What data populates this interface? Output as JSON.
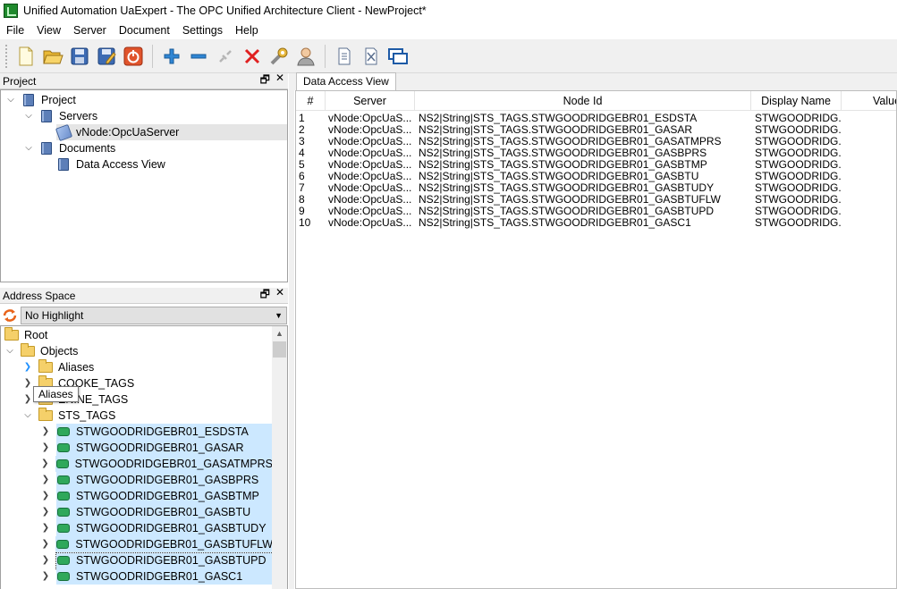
{
  "window": {
    "title": "Unified Automation UaExpert - The OPC Unified Architecture Client - NewProject*"
  },
  "menu": [
    "File",
    "View",
    "Server",
    "Document",
    "Settings",
    "Help"
  ],
  "toolbar": {
    "buttons": [
      "new-project-icon",
      "open-project-icon",
      "save-project-icon",
      "save-as-icon",
      "quit-icon",
      "add-server-icon",
      "remove-server-icon",
      "connect-icon",
      "disconnect-icon",
      "settings-icon",
      "user-icon",
      "add-document-icon",
      "remove-document-icon",
      "window-icon"
    ]
  },
  "project_panel": {
    "title": "Project",
    "float_glyph": "🗗",
    "close_glyph": "✕",
    "tree": [
      {
        "label": "Project",
        "level": 0,
        "expanded": true,
        "icon": "book-icon"
      },
      {
        "label": "Servers",
        "level": 1,
        "expanded": true,
        "icon": "book-icon"
      },
      {
        "label": "vNode:OpcUaServer",
        "level": 2,
        "icon": "server-icon",
        "selected": true
      },
      {
        "label": "Documents",
        "level": 1,
        "expanded": true,
        "icon": "book-icon"
      },
      {
        "label": "Data Access View",
        "level": 2,
        "icon": "book-icon"
      }
    ]
  },
  "address_panel": {
    "title": "Address Space",
    "float_glyph": "🗗",
    "close_glyph": "✕",
    "highlight_value": "No Highlight",
    "tooltip": "Aliases",
    "tree": [
      {
        "label": "Root",
        "level": 0,
        "icon": "folder-icon"
      },
      {
        "label": "Objects",
        "level": 1,
        "expanded": true,
        "icon": "folder-icon"
      },
      {
        "label": "Aliases",
        "level": 2,
        "icon": "folder-icon"
      },
      {
        "label": "COOKE_TAGS",
        "level": 2,
        "icon": "folder-icon"
      },
      {
        "label": "ENINE_TAGS",
        "level": 2,
        "icon": "folder-icon"
      },
      {
        "label": "STS_TAGS",
        "level": 2,
        "expanded": true,
        "icon": "folder-icon"
      },
      {
        "label": "STWGOODRIDGEBR01_ESDSTA",
        "level": 3,
        "icon": "tag-icon",
        "selected": true
      },
      {
        "label": "STWGOODRIDGEBR01_GASAR",
        "level": 3,
        "icon": "tag-icon",
        "selected": true
      },
      {
        "label": "STWGOODRIDGEBR01_GASATMPRS",
        "level": 3,
        "icon": "tag-icon",
        "selected": true
      },
      {
        "label": "STWGOODRIDGEBR01_GASBPRS",
        "level": 3,
        "icon": "tag-icon",
        "selected": true
      },
      {
        "label": "STWGOODRIDGEBR01_GASBTMP",
        "level": 3,
        "icon": "tag-icon",
        "selected": true
      },
      {
        "label": "STWGOODRIDGEBR01_GASBTU",
        "level": 3,
        "icon": "tag-icon",
        "selected": true
      },
      {
        "label": "STWGOODRIDGEBR01_GASBTUDY",
        "level": 3,
        "icon": "tag-icon",
        "selected": true
      },
      {
        "label": "STWGOODRIDGEBR01_GASBTUFLW",
        "level": 3,
        "icon": "tag-icon",
        "selected": true
      },
      {
        "label": "STWGOODRIDGEBR01_GASBTUPD",
        "level": 3,
        "icon": "tag-icon",
        "selected": true,
        "focused": true
      },
      {
        "label": "STWGOODRIDGEBR01_GASC1",
        "level": 3,
        "icon": "tag-icon",
        "selected": true
      }
    ]
  },
  "data_access_view": {
    "tab_label": "Data Access View",
    "columns": [
      "#",
      "Server",
      "Node Id",
      "Display Name",
      "Value"
    ],
    "rows": [
      [
        "1",
        "vNode:OpcUaS...",
        "NS2|String|STS_TAGS.STWGOODRIDGEBR01_ESDSTA",
        "STWGOODRIDG..."
      ],
      [
        "2",
        "vNode:OpcUaS...",
        "NS2|String|STS_TAGS.STWGOODRIDGEBR01_GASAR",
        "STWGOODRIDG..."
      ],
      [
        "3",
        "vNode:OpcUaS...",
        "NS2|String|STS_TAGS.STWGOODRIDGEBR01_GASATMPRS",
        "STWGOODRIDG..."
      ],
      [
        "4",
        "vNode:OpcUaS...",
        "NS2|String|STS_TAGS.STWGOODRIDGEBR01_GASBPRS",
        "STWGOODRIDG..."
      ],
      [
        "5",
        "vNode:OpcUaS...",
        "NS2|String|STS_TAGS.STWGOODRIDGEBR01_GASBTMP",
        "STWGOODRIDG..."
      ],
      [
        "6",
        "vNode:OpcUaS...",
        "NS2|String|STS_TAGS.STWGOODRIDGEBR01_GASBTU",
        "STWGOODRIDG..."
      ],
      [
        "7",
        "vNode:OpcUaS...",
        "NS2|String|STS_TAGS.STWGOODRIDGEBR01_GASBTUDY",
        "STWGOODRIDG..."
      ],
      [
        "8",
        "vNode:OpcUaS...",
        "NS2|String|STS_TAGS.STWGOODRIDGEBR01_GASBTUFLW",
        "STWGOODRIDG..."
      ],
      [
        "9",
        "vNode:OpcUaS...",
        "NS2|String|STS_TAGS.STWGOODRIDGEBR01_GASBTUPD",
        "STWGOODRIDG..."
      ],
      [
        "10",
        "vNode:OpcUaS...",
        "NS2|String|STS_TAGS.STWGOODRIDGEBR01_GASC1",
        "STWGOODRIDG..."
      ]
    ]
  },
  "colors": {
    "selection": "#cce8ff",
    "accent": "#0078d7",
    "tag": "#2fa85b"
  }
}
